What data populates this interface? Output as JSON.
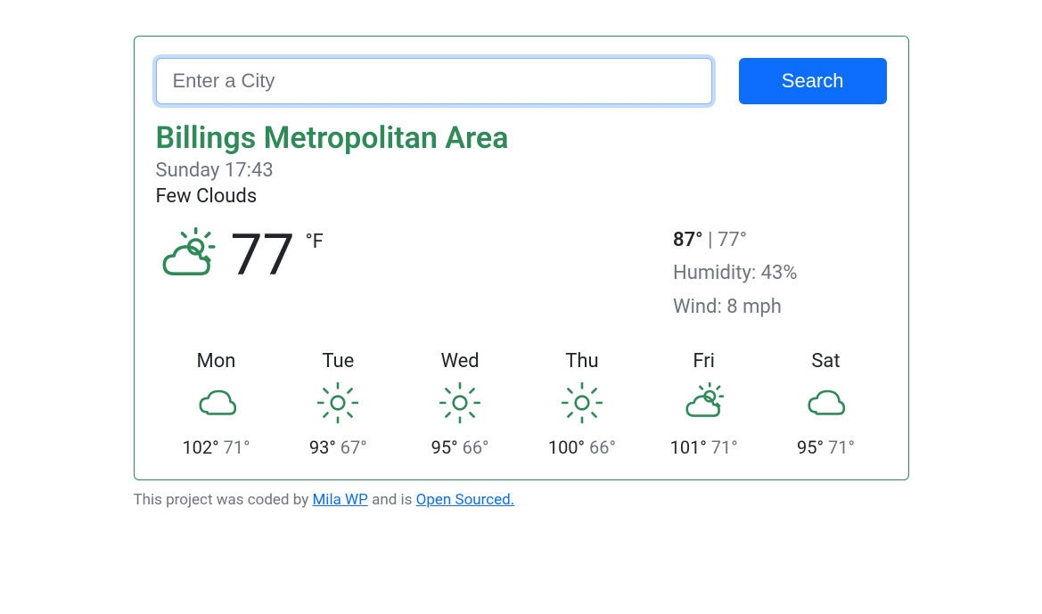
{
  "search": {
    "placeholder": "Enter a City",
    "button_label": "Search"
  },
  "city": "Billings Metropolitan Area",
  "datetime": "Sunday 17:43",
  "description": "Few Clouds",
  "current": {
    "temp": "77",
    "unit": "°F",
    "hi": "87°",
    "lo": "77°",
    "humidity_label": "Humidity: ",
    "humidity_value": "43%",
    "wind_label": "Wind: ",
    "wind_value": "8 mph"
  },
  "forecast": [
    {
      "day": "Mon",
      "icon": "cloud",
      "hi": "102°",
      "lo": "71°"
    },
    {
      "day": "Tue",
      "icon": "sun",
      "hi": "93°",
      "lo": "67°"
    },
    {
      "day": "Wed",
      "icon": "sun",
      "hi": "95°",
      "lo": "66°"
    },
    {
      "day": "Thu",
      "icon": "sun",
      "hi": "100°",
      "lo": "66°"
    },
    {
      "day": "Fri",
      "icon": "partly-cloudy",
      "hi": "101°",
      "lo": "71°"
    },
    {
      "day": "Sat",
      "icon": "cloud",
      "hi": "95°",
      "lo": "71°"
    }
  ],
  "footer": {
    "prefix": "This project was coded by ",
    "author": "Mila WP",
    "middle": " and is ",
    "link": "Open Sourced."
  }
}
